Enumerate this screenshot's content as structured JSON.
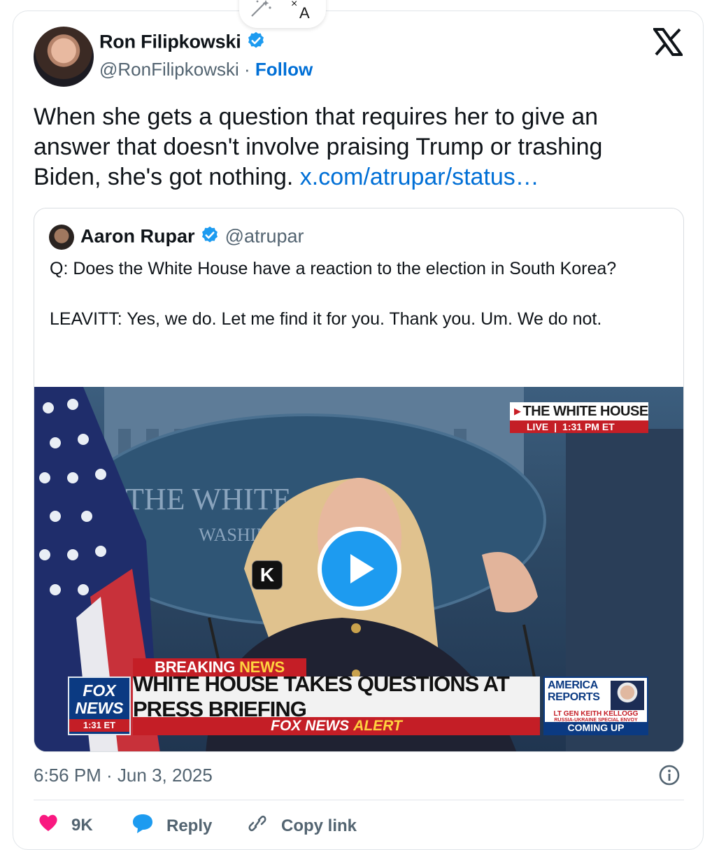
{
  "author": {
    "name": "Ron Filipkowski",
    "handle": "@RonFilipkowski",
    "separator": "·",
    "follow_label": "Follow"
  },
  "tweet": {
    "text": "When she gets a question that requires her to give an answer that doesn't involve praising Trump or trashing Biden, she's got nothing.",
    "link_text": "x.com/atrupar/status…"
  },
  "quoted_tweet": {
    "name": "Aaron Rupar",
    "handle": "@atrupar",
    "text": "Q: Does the White House have a reaction to the election in South Korea?\n\nLEAVITT: Yes, we do. Let me find it for you. Thank you. Um. We do not.",
    "video": {
      "bug_title": "THE WHITE HOUSE",
      "bug_live": "LIVE",
      "bug_time": "1:31 PM ET",
      "seal_text_1": "THE WHITE",
      "seal_text_2": "WASHIN",
      "k_badge": "K",
      "breaking_1": "BREAKING",
      "breaking_2": "NEWS",
      "fox_1": "FOX",
      "fox_2": "NEWS",
      "fox_time": "1:31 ET",
      "headline": "WHITE HOUSE TAKES QUESTIONS AT PRESS BRIEFING",
      "alert_1": "FOX NEWS",
      "alert_2": "ALERT",
      "ar_title": "AMERICA REPORTS",
      "ar_name": "LT GEN KEITH KELLOGG",
      "ar_sub": "RUSSIA-UKRAINE SPECIAL ENVOY",
      "ar_coming": "COMING UP"
    }
  },
  "meta": {
    "timestamp": "6:56 PM · Jun 3, 2025"
  },
  "actions": {
    "likes": "9K",
    "reply": "Reply",
    "copy_link": "Copy link"
  },
  "colors": {
    "link": "#006fd6",
    "verified": "#1d9bf0",
    "like": "#f91880",
    "fox_red": "#c41e26",
    "fox_blue": "#0b3a82"
  },
  "icons": [
    "wand-icon",
    "translate-icon",
    "verified-badge-icon",
    "x-logo-icon",
    "play-icon",
    "info-icon",
    "heart-icon",
    "reply-icon",
    "link-icon"
  ]
}
